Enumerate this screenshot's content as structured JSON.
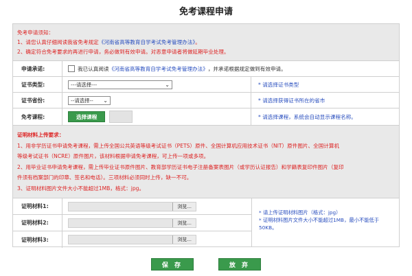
{
  "page_title": "免考课程申请",
  "notice": {
    "heading": "免考申请须知：",
    "line1_prefix": "1、请您认真仔细阅读我省免考规定",
    "line1_link": "《河南省高等教育自学考试免考管理办法》",
    "line1_suffix": "。",
    "line2": "2、确定符合免考要求的再进行申请，务必做到有效申请。对恶意申请者将做延期毕业处理。"
  },
  "commitment": {
    "label": "申请承诺:",
    "text_prefix": "我已认真阅读",
    "link": "《河南省高等教育自学考试免考管理办法》",
    "text_suffix": "，并承诺根据规定做到有效申请。"
  },
  "cert_type": {
    "label": "证书类型:",
    "selected": "---请选择---",
    "hint": "* 请选择证书类型"
  },
  "cert_province": {
    "label": "证书省份:",
    "selected": "--请选择--",
    "hint": "* 请选择获得证书所在的省市"
  },
  "course": {
    "label": "免考课程:",
    "button": "选择课程",
    "hint": "* 请选择课程，系统会自动显示课程名称。"
  },
  "upload_requirements": {
    "heading": "证明材料上传要求：",
    "lines": [
      "1、用非学历证书申请免考课程，需上传全国公共英语等级考试证书（PETS）原件、全国计算机应用技术证书（NIT）原件图片、全国计算机",
      "等级考试证书（NCRE）原件图片，该材料根据申请免考课程，可上传一项或多项。",
      "2、用毕业证书申请免考课程，需上传毕业证书原件图片、教育部学历证书电子注册备案表图片（或学历认证报告）和学籍表复印件图片（复印",
      "件须有档案部门的印章、签名和电话）。三项材料必须同时上传，缺一不可。",
      "3、证明材料图片文件大小不能超过1MB，格式：jpg。"
    ]
  },
  "uploads": [
    {
      "label": "证明材料1:",
      "browse": "浏览..."
    },
    {
      "label": "证明材料2:",
      "browse": "浏览..."
    },
    {
      "label": "证明材料3:",
      "browse": "浏览..."
    }
  ],
  "upload_hint": {
    "line1": "* 请上传证明材料图片（格式：jpg）",
    "line2": "* 证明材料图片文件大小不能超过1MB，最小不能低于50KB。"
  },
  "actions": {
    "save": "保 存",
    "cancel": "放 弃"
  },
  "colors": {
    "accent_green": "#3a9a4c",
    "warning_red": "#dd2222",
    "link_blue": "#2a4fbf"
  }
}
